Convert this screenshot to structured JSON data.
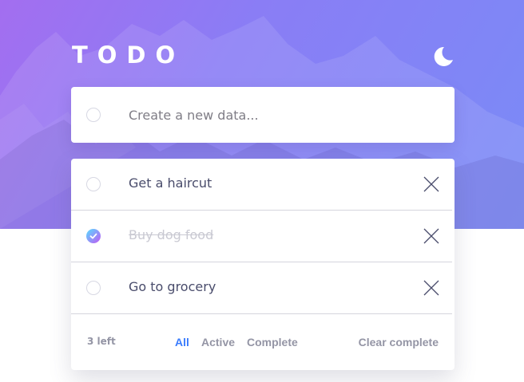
{
  "header": {
    "title": "TODO",
    "theme_icon": "moon-icon"
  },
  "new_todo": {
    "placeholder": "Create a new data..."
  },
  "todos": [
    {
      "label": "Get a haircut",
      "completed": false
    },
    {
      "label": "Buy dog food",
      "completed": true
    },
    {
      "label": "Go to grocery",
      "completed": false
    }
  ],
  "footer": {
    "items_left": "3 left",
    "filters": [
      "All",
      "Active",
      "Complete"
    ],
    "active_filter": "All",
    "clear_label": "Clear complete"
  },
  "colors": {
    "accent": "#3a7cfd",
    "check_gradient_start": "#57ddff",
    "check_gradient_end": "#c058f3",
    "hero_gradient_start": "#a36ef0",
    "hero_gradient_end": "#7a8bf7"
  },
  "icons": {
    "delete": "close-icon",
    "checked": "check-icon"
  }
}
